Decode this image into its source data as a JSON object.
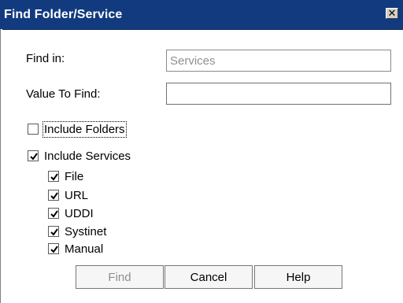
{
  "dialog": {
    "title": "Find Folder/Service",
    "close_glyph": "✕"
  },
  "fields": {
    "find_in_label": "Find in:",
    "find_in_value": "Services",
    "value_to_find_label": "Value To Find:",
    "value_to_find_value": ""
  },
  "options": {
    "include_folders": {
      "label": "Include Folders",
      "checked": false
    },
    "include_services": {
      "label": "Include Services",
      "checked": true
    },
    "service_types": [
      {
        "label": "File",
        "checked": true
      },
      {
        "label": "URL",
        "checked": true
      },
      {
        "label": "UDDI",
        "checked": true
      },
      {
        "label": "Systinet",
        "checked": true
      },
      {
        "label": "Manual",
        "checked": true
      }
    ]
  },
  "buttons": {
    "find_label": "Find",
    "find_enabled": false,
    "cancel_label": "Cancel",
    "help_label": "Help"
  },
  "colors": {
    "titlebar": "#123a7e",
    "title_text": "#ffffff",
    "disabled_text": "#8f8f8f"
  }
}
